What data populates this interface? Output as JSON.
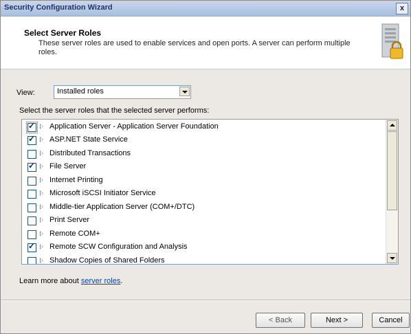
{
  "window": {
    "title": "Security Configuration Wizard",
    "close_label": "x"
  },
  "header": {
    "title": "Select Server Roles",
    "description": "These server roles are used to enable services and open ports. A server can perform multiple roles."
  },
  "view": {
    "label": "View:",
    "selected": "Installed roles"
  },
  "instruction": "Select the server roles that the selected server performs:",
  "roles": [
    {
      "label": "Application Server - Application Server Foundation",
      "checked": true
    },
    {
      "label": "ASP.NET State Service",
      "checked": true
    },
    {
      "label": "Distributed Transactions",
      "checked": false
    },
    {
      "label": "File Server",
      "checked": true
    },
    {
      "label": "Internet Printing",
      "checked": false
    },
    {
      "label": "Microsoft iSCSI Initiator Service",
      "checked": false
    },
    {
      "label": "Middle-tier Application Server (COM+/DTC)",
      "checked": false
    },
    {
      "label": "Print Server",
      "checked": false
    },
    {
      "label": "Remote COM+",
      "checked": false
    },
    {
      "label": "Remote SCW Configuration and Analysis",
      "checked": true
    },
    {
      "label": "Shadow Copies of Shared Folders",
      "checked": false
    }
  ],
  "learn_more": {
    "prefix": "Learn more about ",
    "link": "server roles",
    "suffix": "."
  },
  "buttons": {
    "back": "< Back",
    "next": "Next >",
    "cancel": "Cancel"
  }
}
